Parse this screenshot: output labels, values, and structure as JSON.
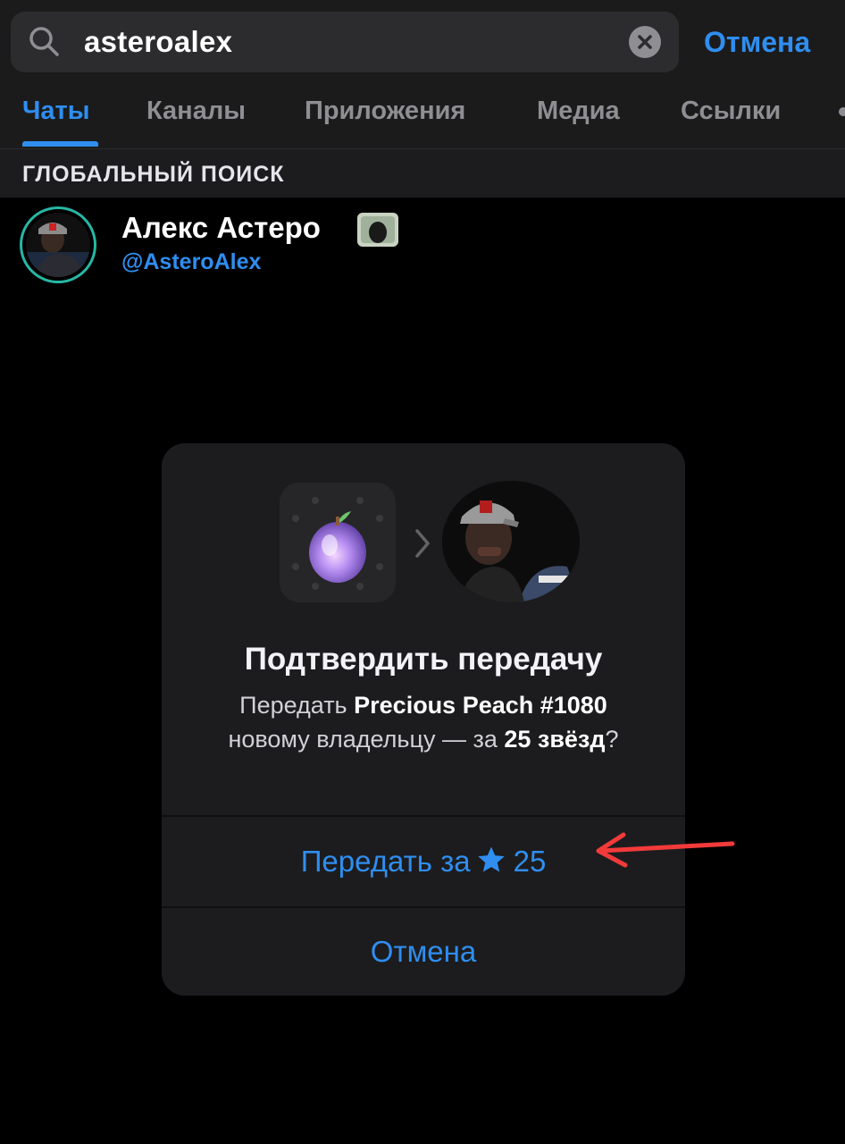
{
  "search": {
    "query": "asteroalex",
    "cancel_label": "Отмена"
  },
  "tabs": [
    {
      "label": "Чаты",
      "active": true
    },
    {
      "label": "Каналы",
      "active": false
    },
    {
      "label": "Приложения",
      "active": false
    },
    {
      "label": "Медиа",
      "active": false
    },
    {
      "label": "Ссылки",
      "active": false
    }
  ],
  "section": {
    "title": "ГЛОБАЛЬНЫЙ ПОИСК"
  },
  "result": {
    "name": "Алекс Астеро",
    "username": "@AsteroAlex"
  },
  "dialog": {
    "title": "Подтвердить передачу",
    "text_prefix": "Передать ",
    "gift_name": "Precious Peach #1080",
    "text_middle": "новому владельцу — за ",
    "price_text": "25 звёзд",
    "text_suffix": "?",
    "confirm_prefix": "Передать за",
    "confirm_amount": "25",
    "cancel_label": "Отмена"
  },
  "colors": {
    "accent": "#2f8ef0",
    "background": "#000000",
    "dialog_bg": "#1c1c1e",
    "annotation_arrow": "#f23a3a",
    "avatar_ring": "#27b7a6"
  },
  "icons": {
    "search": "search-icon",
    "clear": "clear-icon",
    "chevron": "chevron-right-icon",
    "star": "star-icon",
    "gift": "peach-gift-icon"
  }
}
